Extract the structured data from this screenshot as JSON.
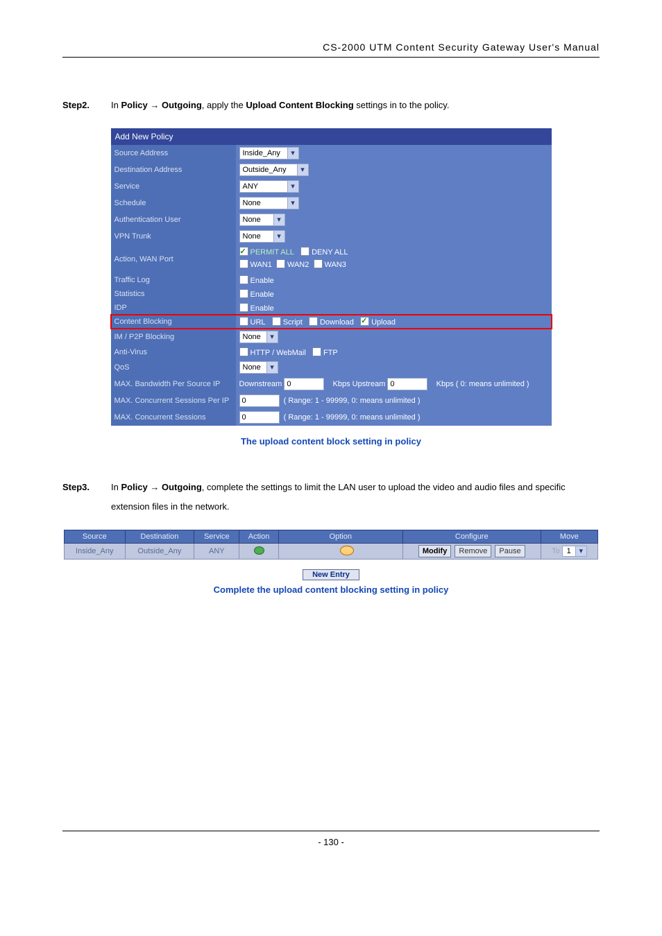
{
  "header": "CS-2000 UTM Content Security Gateway User's Manual",
  "step2": {
    "label": "Step2.",
    "pre": "In ",
    "path1": "Policy",
    "arrow": " → ",
    "path2": "Outgoing",
    "mid": ", apply the ",
    "bold": "Upload Content Blocking",
    "post": " settings in to the policy."
  },
  "form": {
    "title": "Add New Policy",
    "rows": {
      "source_lab": "Source Address",
      "source_val": "Inside_Any",
      "dest_lab": "Destination Address",
      "dest_val": "Outside_Any",
      "service_lab": "Service",
      "service_val": "ANY",
      "schedule_lab": "Schedule",
      "schedule_val": "None",
      "auth_lab": "Authentication User",
      "auth_val": "None",
      "vpn_lab": "VPN Trunk",
      "vpn_val": "None",
      "action_lab": "Action, WAN Port",
      "action_permit": "PERMIT ALL",
      "action_deny": "DENY ALL",
      "action_w1": "WAN1",
      "action_w2": "WAN2",
      "action_w3": "WAN3",
      "traffic_lab": "Traffic Log",
      "enable": "Enable",
      "stats_lab": "Statistics",
      "idp_lab": "IDP",
      "cb_lab": "Content Blocking",
      "cb_url": "URL",
      "cb_script": "Script",
      "cb_download": "Download",
      "cb_upload": "Upload",
      "im_lab": "IM / P2P Blocking",
      "im_val": "None",
      "av_lab": "Anti-Virus",
      "av_http": "HTTP / WebMail",
      "av_ftp": "FTP",
      "qos_lab": "QoS",
      "qos_val": "None",
      "bw_lab": "MAX. Bandwidth Per Source IP",
      "bw_down": "Downstream",
      "bw_down_val": "0",
      "bw_up": "Kbps Upstream",
      "bw_up_val": "0",
      "bw_note": "Kbps ( 0: means unlimited )",
      "csip_lab": "MAX. Concurrent Sessions Per IP",
      "csip_val": "0",
      "range_note": "( Range: 1 - 99999, 0: means unlimited )",
      "cs_lab": "MAX. Concurrent Sessions",
      "cs_val": "0"
    }
  },
  "caption1": "The upload content block setting in policy",
  "step3": {
    "label": "Step3.",
    "pre": "In ",
    "path1": "Policy",
    "arrow": " → ",
    "path2": "Outgoing",
    "post": ", complete the settings to limit the LAN user to upload the video and audio files and specific extension files in the network."
  },
  "plist": {
    "headers": [
      "Source",
      "Destination",
      "Service",
      "Action",
      "Option",
      "Configure",
      "Move"
    ],
    "row": {
      "source": "Inside_Any",
      "dest": "Outside_Any",
      "service": "ANY",
      "modify": "Modify",
      "remove": "Remove",
      "pause": "Pause",
      "to": "To",
      "to_val": "1"
    },
    "new_entry": "New Entry"
  },
  "caption2": "Complete the upload content blocking setting in policy",
  "page_num": "- 130 -"
}
